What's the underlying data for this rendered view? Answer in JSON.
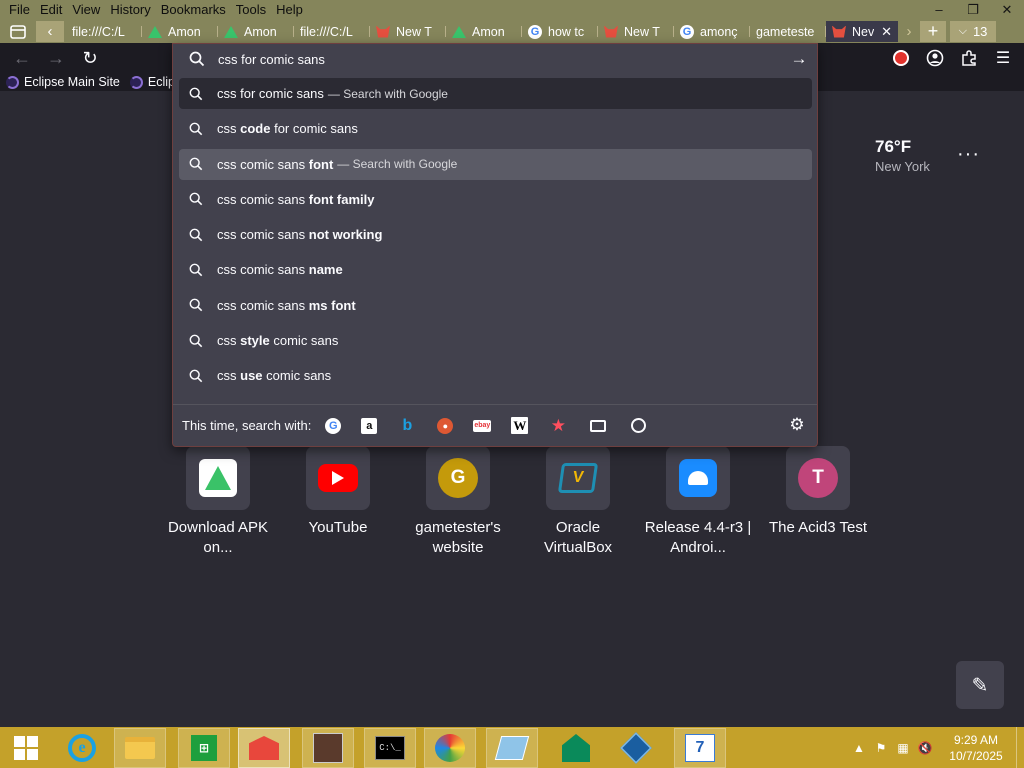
{
  "menubar": {
    "items": [
      "File",
      "Edit",
      "View",
      "History",
      "Bookmarks",
      "Tools",
      "Help"
    ]
  },
  "window_controls": {
    "minimize": "–",
    "restore": "❐",
    "close": "✕"
  },
  "tabs": [
    {
      "label": "file:///C:/L",
      "favicon": "none"
    },
    {
      "label": "Amon",
      "favicon": "green-mountain"
    },
    {
      "label": "Amon",
      "favicon": "green-mountain"
    },
    {
      "label": "file:///C:/L",
      "favicon": "none"
    },
    {
      "label": "New T",
      "favicon": "red-fox"
    },
    {
      "label": "Amon",
      "favicon": "green-mountain"
    },
    {
      "label": "how tc",
      "favicon": "google"
    },
    {
      "label": "New T",
      "favicon": "red-fox"
    },
    {
      "label": "amonç",
      "favicon": "google"
    },
    {
      "label": "gameteste",
      "favicon": "none"
    }
  ],
  "active_tab": {
    "label": "Nev",
    "favicon": "red-fox"
  },
  "tab_count": "13",
  "bookmarks": [
    {
      "label": "Eclipse Main Site"
    },
    {
      "label": "Eclips"
    }
  ],
  "urlbar": {
    "value": "css for comic sans",
    "one_off_label": "This time, search with:",
    "suggestions": [
      {
        "pre": "css for comic sans",
        "bold": "",
        "post": "",
        "action": "— Search with Google",
        "state": "first"
      },
      {
        "pre": "css ",
        "bold": "code",
        "post": " for comic sans",
        "action": "",
        "state": ""
      },
      {
        "pre": "css comic sans ",
        "bold": "font",
        "post": "",
        "action": "— Search with Google",
        "state": "selected"
      },
      {
        "pre": "css comic sans ",
        "bold": "font family",
        "post": "",
        "action": "",
        "state": ""
      },
      {
        "pre": "css comic sans ",
        "bold": "not working",
        "post": "",
        "action": "",
        "state": ""
      },
      {
        "pre": "css comic sans ",
        "bold": "name",
        "post": "",
        "action": "",
        "state": ""
      },
      {
        "pre": "css comic sans ",
        "bold": "ms font",
        "post": "",
        "action": "",
        "state": ""
      },
      {
        "pre": "css ",
        "bold": "style",
        "post": " comic sans",
        "action": "",
        "state": ""
      },
      {
        "pre": "css ",
        "bold": "use",
        "post": " comic sans",
        "action": "",
        "state": ""
      }
    ]
  },
  "weather": {
    "temp": "76°F",
    "city": "New York"
  },
  "shortcuts": [
    {
      "label": "Download APK on...",
      "icon": "apk-icon"
    },
    {
      "label": "YouTube",
      "icon": "youtube-icon"
    },
    {
      "label": "gametester's website",
      "icon": "letter",
      "letter": "G"
    },
    {
      "label": "Oracle VirtualBox",
      "icon": "virtualbox-icon"
    },
    {
      "label": "Release 4.4-r3 | Androi...",
      "icon": "android-icon"
    },
    {
      "label": "The Acid3 Test",
      "icon": "letter",
      "letter": "T"
    }
  ],
  "colors": {
    "titlebar": "#85855b",
    "toolbar": "#1c1b22",
    "page_bg": "#2b2a33",
    "dropdown_bg": "#42414d",
    "selected_row": "#5b5b66",
    "taskbar": "#c4a12a",
    "letter_g": "#c49a0b",
    "letter_t": "#c0457a"
  },
  "taskbar": {
    "clock_time": "9:29 AM",
    "clock_date": "10/7/2025"
  }
}
